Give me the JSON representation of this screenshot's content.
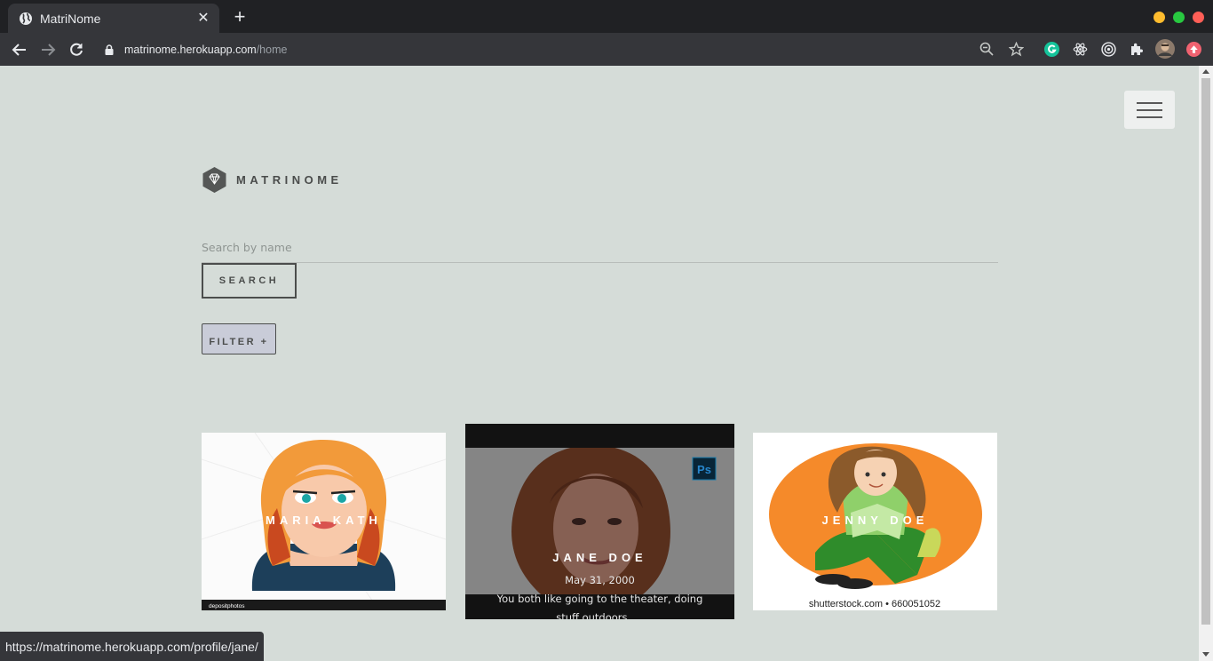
{
  "browser": {
    "tab_title": "MatriNome",
    "url_host": "matrinome.herokuapp.com",
    "url_path": "/home",
    "status_url": "https://matrinome.herokuapp.com/profile/jane/"
  },
  "colors": {
    "page_bg": "#d5dcd8",
    "win_min": "#febc2e",
    "win_max": "#28c840",
    "win_close": "#ff5f57"
  },
  "header": {
    "brand": "MATRINOME"
  },
  "search": {
    "placeholder": "Search by name",
    "button_label": "SEARCH"
  },
  "filter": {
    "button_label": "FILTER +"
  },
  "profiles": [
    {
      "name": "MARIA KATH",
      "image_credit": "depositphotos"
    },
    {
      "name": "JANE DOE",
      "date": "May 31, 2000",
      "description": "You both like going to the theater, doing stuff outdoors, ..."
    },
    {
      "name": "JENNY DOE",
      "image_credit": "shutterstock.com • 660051052"
    }
  ]
}
